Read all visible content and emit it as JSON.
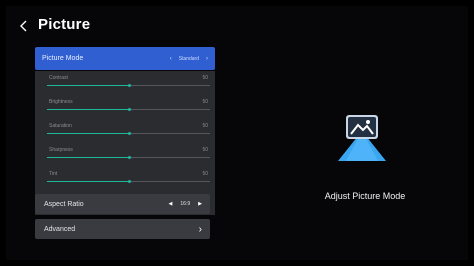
{
  "header": {
    "title": "Picture"
  },
  "picture_mode": {
    "label": "Picture Mode",
    "value": "Standard"
  },
  "sliders": [
    {
      "label": "Contrast",
      "value": "50",
      "level": 0.5
    },
    {
      "label": "Brightness",
      "value": "50",
      "level": 0.5
    },
    {
      "label": "Saturation",
      "value": "50",
      "level": 0.5
    },
    {
      "label": "Sharpness",
      "value": "50",
      "level": 0.5
    },
    {
      "label": "Tint",
      "value": "50",
      "level": 0.5
    }
  ],
  "aspect_ratio": {
    "label": "Aspect Ratio",
    "value": "16:9"
  },
  "advanced": {
    "label": "Advanced"
  },
  "preview": {
    "caption": "Adjust Picture Mode",
    "icon": "picture-mode-icon"
  },
  "colors": {
    "accent": "#2f5fd0",
    "slider": "#1fb89a",
    "panel": "#2b2c30",
    "row": "#3a3b40"
  }
}
